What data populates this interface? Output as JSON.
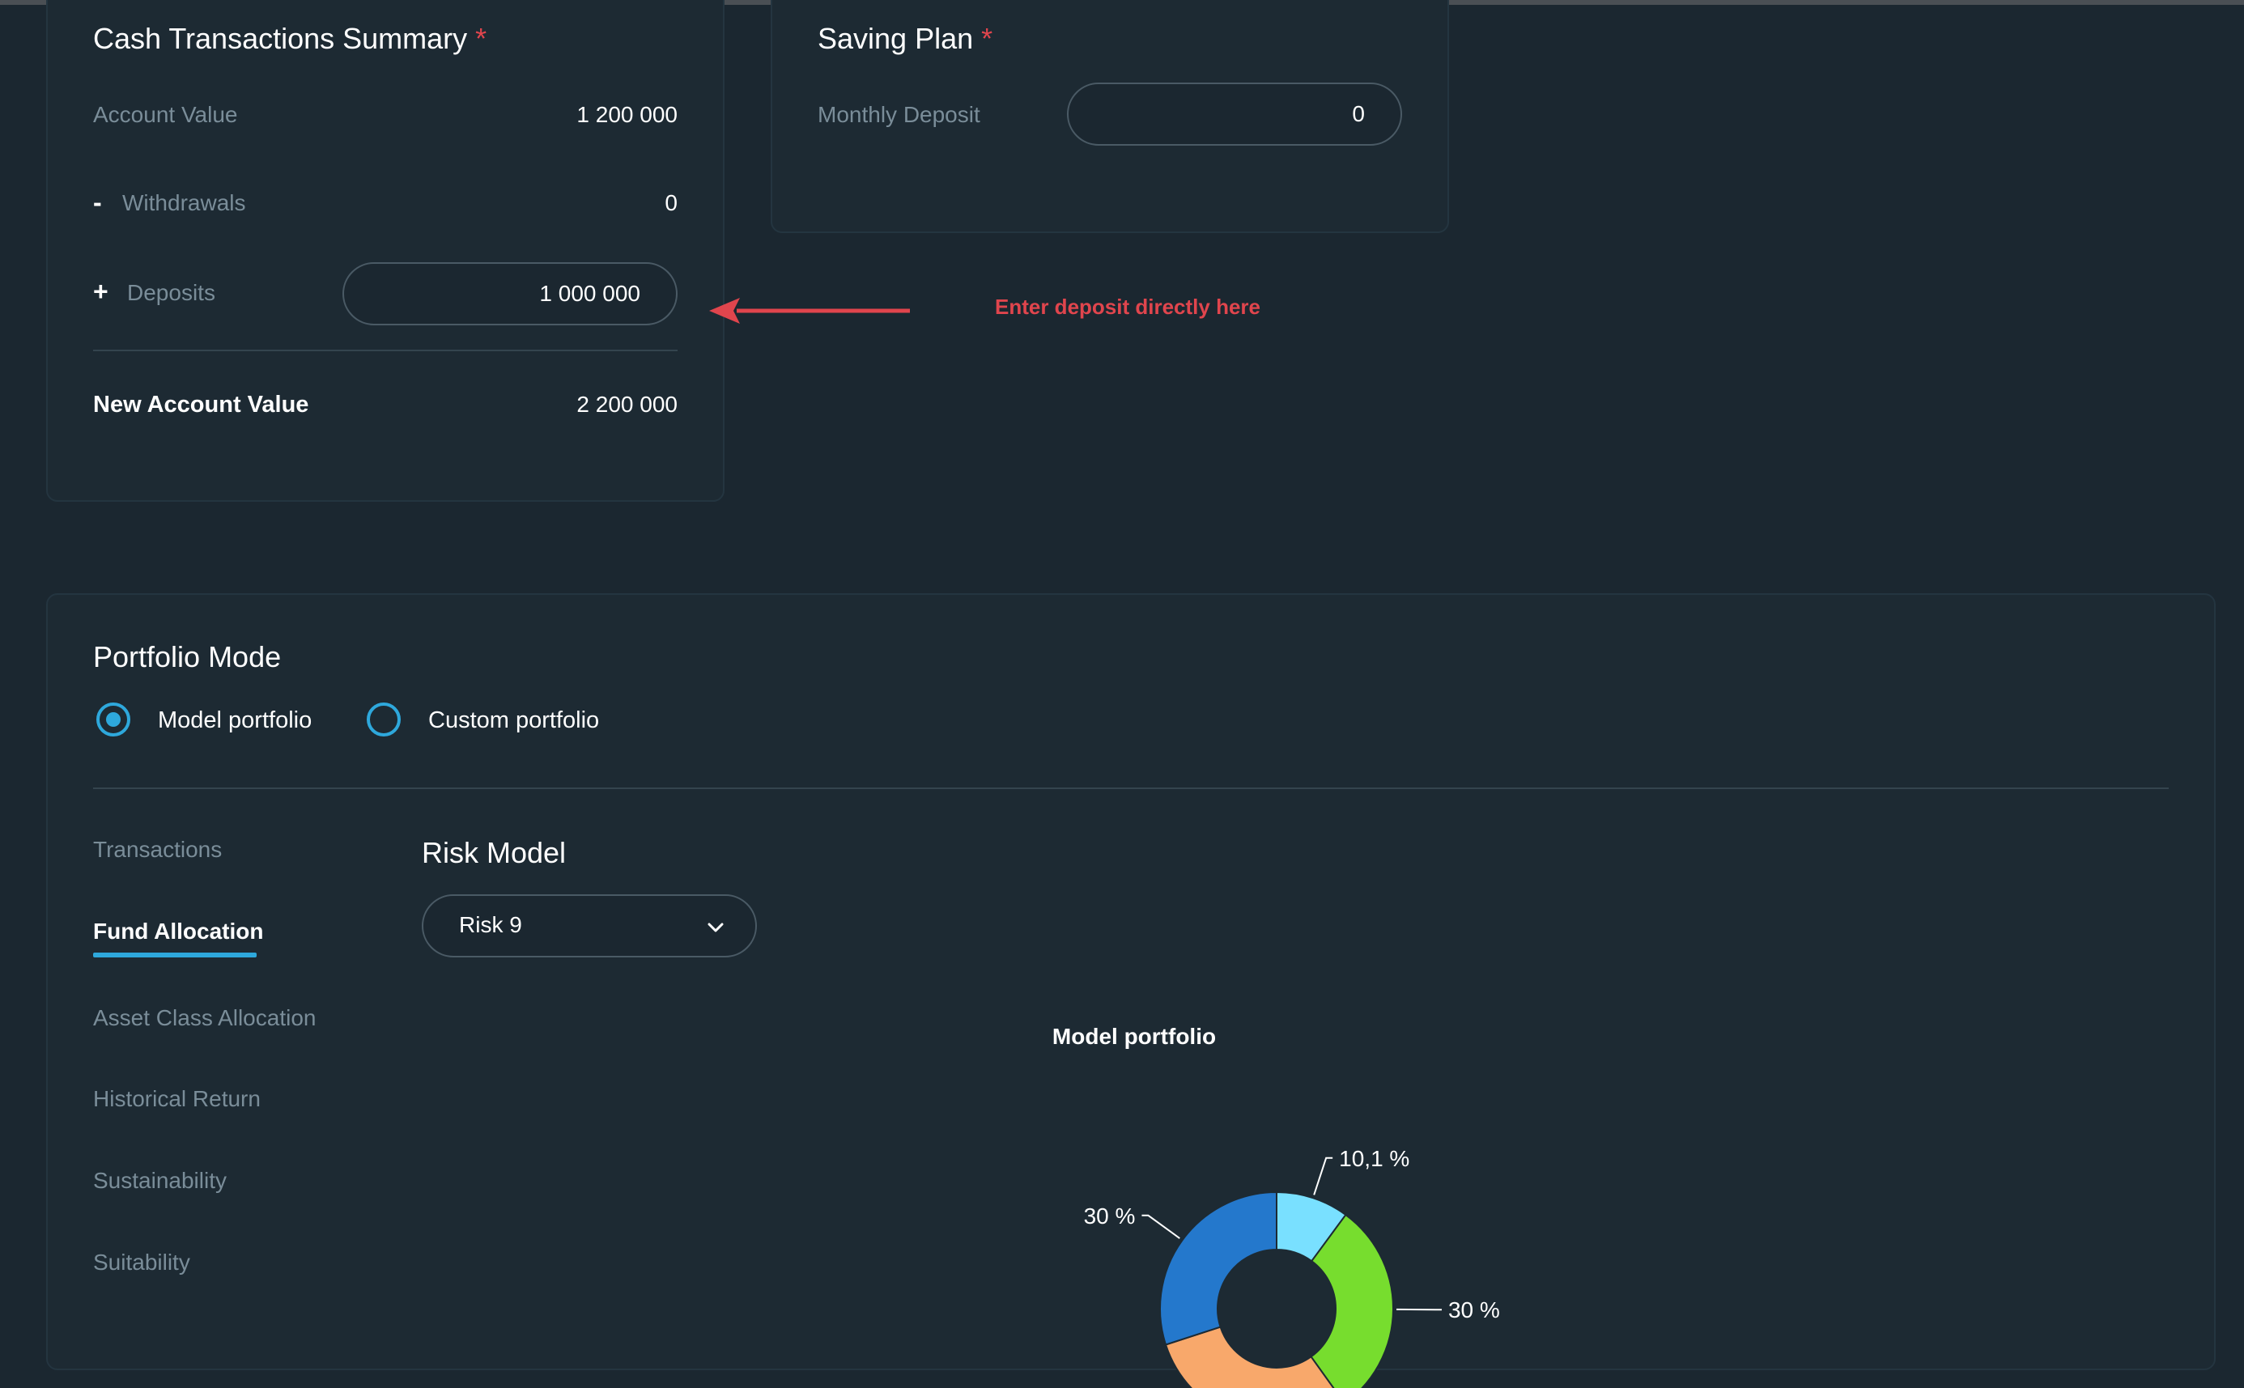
{
  "cash_summary": {
    "title": "Cash Transactions Summary",
    "required_mark": "*",
    "account_value_label": "Account Value",
    "account_value": "1 200 000",
    "withdrawals_sign": "-",
    "withdrawals_label": "Withdrawals",
    "withdrawals_value": "0",
    "deposits_sign": "+",
    "deposits_label": "Deposits",
    "deposits_value": "1 000 000",
    "new_account_value_label": "New Account Value",
    "new_account_value": "2 200 000"
  },
  "saving_plan": {
    "title": "Saving Plan",
    "required_mark": "*",
    "monthly_deposit_label": "Monthly Deposit",
    "monthly_deposit_value": "0"
  },
  "annotation": {
    "text": "Enter deposit directly here",
    "color": "#e0454d"
  },
  "portfolio_mode": {
    "title": "Portfolio Mode",
    "options": [
      {
        "label": "Model portfolio",
        "selected": true
      },
      {
        "label": "Custom portfolio",
        "selected": false
      }
    ]
  },
  "side_nav": {
    "items": [
      {
        "label": "Transactions",
        "active": false
      },
      {
        "label": "Fund Allocation",
        "active": true
      },
      {
        "label": "Asset Class Allocation",
        "active": false
      },
      {
        "label": "Historical Return",
        "active": false
      },
      {
        "label": "Sustainability",
        "active": false
      },
      {
        "label": "Suitability",
        "active": false
      }
    ]
  },
  "risk_model": {
    "title": "Risk Model",
    "selected": "Risk 9"
  },
  "colors": {
    "accent": "#2ea8dc",
    "required": "#e0454d"
  },
  "chart_data": {
    "type": "pie",
    "title": "Model portfolio",
    "slices": [
      {
        "label": "10,1 %",
        "value": 10.1,
        "color": "#79e0ff"
      },
      {
        "label": "30 %",
        "value": 30,
        "color": "#77dd2e"
      },
      {
        "label": "",
        "value": 29.9,
        "color": "#f8a86b"
      },
      {
        "label": "30 %",
        "value": 30,
        "color": "#2478cc"
      }
    ]
  }
}
